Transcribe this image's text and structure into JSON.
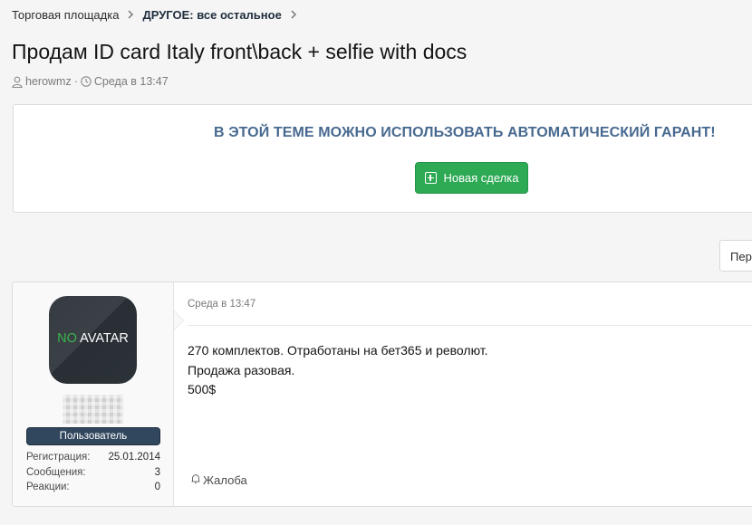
{
  "breadcrumb": {
    "items": [
      "Торговая площадка",
      "ДРУГОЕ: все остальное"
    ]
  },
  "thread": {
    "title": "Продам ID card Italy front\\back + selfie with docs",
    "author": "herowmz",
    "date": "Среда в 13:47"
  },
  "guarantee": {
    "notice": "В ЭТОЙ ТЕМЕ МОЖНО ИСПОЛЬЗОВАТЬ АВТОМАТИЧЕСКИЙ ГАРАНТ!",
    "button_label": "Новая сделка",
    "button_color": "#2eaa55"
  },
  "page_nav": {
    "label": "Пер"
  },
  "post": {
    "avatar": {
      "no": "NO",
      "avatar": "AVATAR"
    },
    "role": "Пользователь",
    "stats": [
      {
        "label": "Регистрация:",
        "value": "25.01.2014"
      },
      {
        "label": "Сообщения:",
        "value": "3"
      },
      {
        "label": "Реакции:",
        "value": "0"
      }
    ],
    "date": "Среда в 13:47",
    "body": [
      "270 комплектов. Отработаны на бет365 и револют.",
      "Продажа разовая.",
      "500$"
    ],
    "report_label": "Жалоба"
  },
  "icons": {
    "breadcrumb_separator": "chevron-right-icon",
    "author": "user-icon",
    "date": "clock-icon",
    "deal": "plus-square-icon",
    "report": "bell-icon"
  }
}
